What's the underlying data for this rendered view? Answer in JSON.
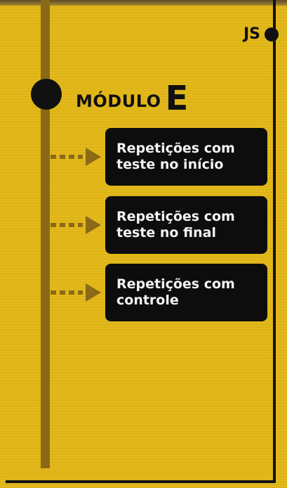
{
  "module": {
    "word": "MÓDULO",
    "letter": "E"
  },
  "tag": {
    "text": "JS"
  },
  "topics": [
    {
      "line1": "Repetições com",
      "line2": "teste no início"
    },
    {
      "line1": "Repetições com",
      "line2": "teste no final"
    },
    {
      "line1": "Repetições com",
      "line2": "controle"
    }
  ],
  "colors": {
    "background": "#e3b81a",
    "timeline": "#8a6a17",
    "box": "#0d0d0d",
    "text_light": "#f2f2f2",
    "ink": "#111111"
  }
}
